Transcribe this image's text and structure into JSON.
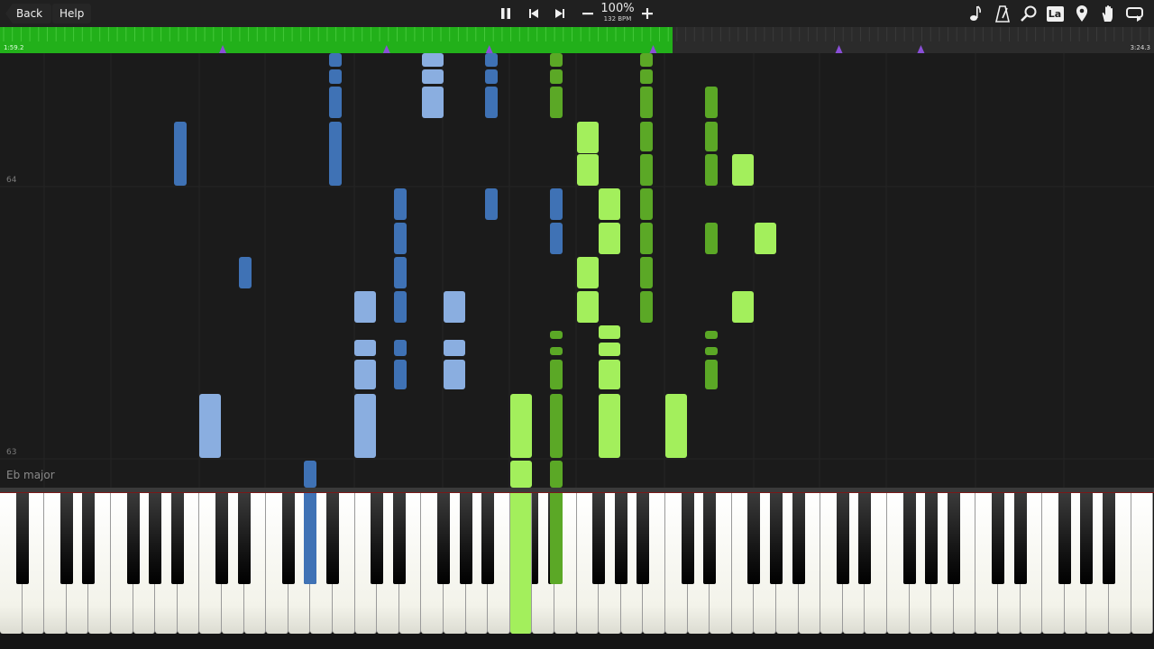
{
  "toolbar": {
    "back_label": "Back",
    "help_label": "Help",
    "speed": "100%",
    "bpm": "132 BPM",
    "icons_center": [
      "pause-icon",
      "skip-back-icon",
      "skip-forward-icon",
      "minus-icon",
      "plus-icon"
    ],
    "icons_right": [
      "note-icon",
      "metronome-icon",
      "search-icon",
      "label-icon",
      "location-pin-icon",
      "hand-icon",
      "loop-icon"
    ],
    "label_icon_text": "La"
  },
  "timeline": {
    "current_time": "1:59.2",
    "total_time": "3:24.3",
    "progress_fraction": 0.583,
    "marker_fractions": [
      0.193,
      0.335,
      0.424,
      0.566,
      0.727,
      0.798
    ]
  },
  "roll": {
    "row_labels": [
      "64",
      "63"
    ],
    "key_signature": "Eb major"
  },
  "colors": {
    "timeline_green": "#22b01a",
    "marker_purple": "#8a4fd8",
    "blue_dark": "#3f72b5",
    "blue_light": "#8aaee0",
    "green_dark": "#5ba826",
    "green_light": "#a3ef5c",
    "background": "#1b1b1b"
  }
}
